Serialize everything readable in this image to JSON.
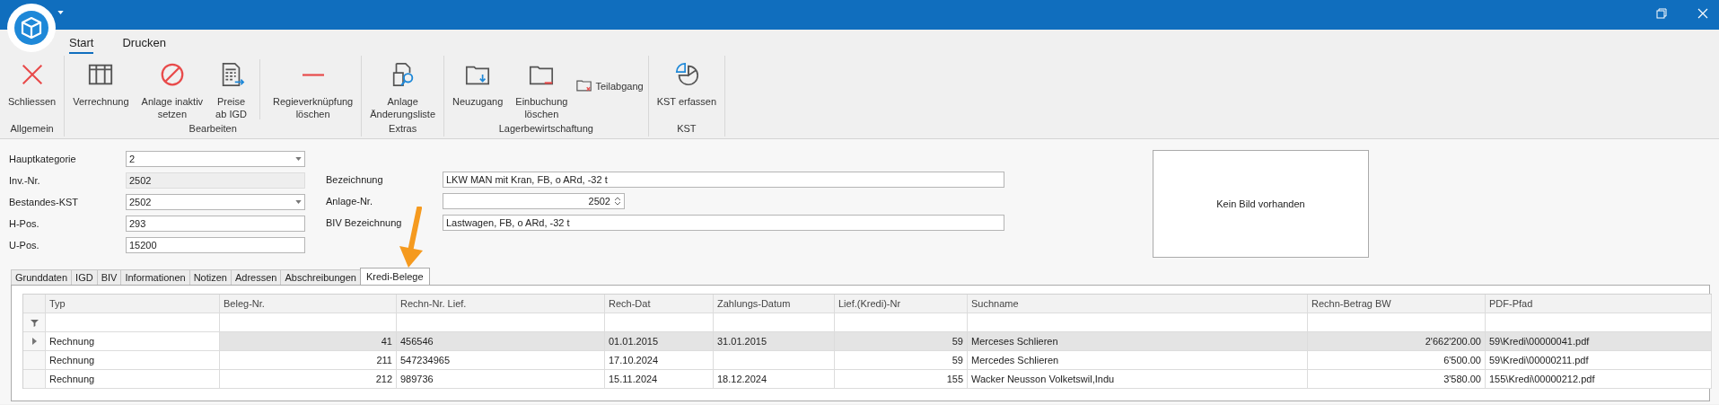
{
  "ribbon_tabs": [
    {
      "label": "Start",
      "selected": true
    },
    {
      "label": "Drucken",
      "selected": false
    }
  ],
  "ribbon_groups": [
    {
      "label": "Allgemein",
      "buttons": [
        {
          "kind": "large",
          "lines": [
            "Schliessen"
          ]
        }
      ]
    },
    {
      "label": "Bearbeiten",
      "buttons": [
        {
          "kind": "large",
          "lines": [
            "Verrechnung"
          ]
        },
        {
          "kind": "large",
          "lines": [
            "Anlage inaktiv",
            "setzen"
          ]
        },
        {
          "kind": "large",
          "lines": [
            "Preise",
            "ab IGD"
          ]
        },
        {
          "kind": "separator"
        },
        {
          "kind": "large",
          "lines": [
            "Regieverknüpfung",
            "löschen"
          ]
        }
      ]
    },
    {
      "label": "Extras",
      "buttons": [
        {
          "kind": "large",
          "lines": [
            "Anlage",
            "Änderungsliste"
          ]
        }
      ]
    },
    {
      "label": "Lagerbewirtschaftung",
      "buttons": [
        {
          "kind": "large",
          "lines": [
            "Neuzugang"
          ]
        },
        {
          "kind": "large",
          "lines": [
            "Einbuchung",
            "löschen"
          ]
        },
        {
          "kind": "small",
          "lines": [
            "Teilabgang"
          ]
        }
      ]
    },
    {
      "label": "KST",
      "buttons": [
        {
          "kind": "large",
          "lines": [
            "KST erfassen"
          ]
        }
      ]
    }
  ],
  "form": {
    "left": [
      {
        "label": "Hauptkategorie",
        "value": "2",
        "kind": "combo"
      },
      {
        "label": "Inv.-Nr.",
        "value": "2502",
        "kind": "readonly"
      },
      {
        "label": "Bestandes-KST",
        "value": "2502",
        "kind": "combo"
      },
      {
        "label": "H-Pos.",
        "value": "293",
        "kind": "text"
      },
      {
        "label": "U-Pos.",
        "value": "15200",
        "kind": "text"
      }
    ],
    "right": [
      {
        "label": "Bezeichnung",
        "value": "LKW MAN mit Kran, FB, o ARd, -32 t",
        "kind": "text"
      },
      {
        "label": "Anlage-Nr.",
        "value": "2502",
        "kind": "spin"
      },
      {
        "label": "BIV Bezeichnung",
        "value": "Lastwagen, FB, o ARd, -32 t",
        "kind": "text"
      }
    ],
    "image_placeholder": "Kein Bild vorhanden"
  },
  "detail_tabs": [
    {
      "label": "Grunddaten",
      "selected": false
    },
    {
      "label": "IGD",
      "selected": false
    },
    {
      "label": "BIV",
      "selected": false
    },
    {
      "label": "Informationen",
      "selected": false
    },
    {
      "label": "Notizen",
      "selected": false
    },
    {
      "label": "Adressen",
      "selected": false
    },
    {
      "label": "Abschreibungen",
      "selected": false
    },
    {
      "label": "Kredi-Belege",
      "selected": true
    }
  ],
  "annotation": {
    "kind": "arrow"
  },
  "table": {
    "columns": [
      "Typ",
      "Beleg-Nr.",
      "Rechn-Nr. Lief.",
      "Rech-Dat",
      "Zahlungs-Datum",
      "Lief.(Kredi)-Nr",
      "Suchname",
      "Rechn-Betrag BW",
      "PDF-Pfad"
    ],
    "rows": [
      {
        "selected": true,
        "cells": [
          "Rechnung",
          "41",
          "456546",
          "01.01.2015",
          "31.01.2015",
          "59",
          "Merceses Schlieren",
          "2'662'200.00",
          "59\\Kredi\\00000041.pdf"
        ]
      },
      {
        "selected": false,
        "cells": [
          "Rechnung",
          "211",
          "547234965",
          "17.10.2024",
          "",
          "59",
          "Mercedes Schlieren",
          "6'500.00",
          "59\\Kredi\\00000211.pdf"
        ]
      },
      {
        "selected": false,
        "cells": [
          "Rechnung",
          "212",
          "989736",
          "15.11.2024",
          "18.12.2024",
          "155",
          "Wacker Neusson Volketswil,Indu",
          "3'580.00",
          "155\\Kredi\\00000212.pdf"
        ]
      }
    ]
  }
}
